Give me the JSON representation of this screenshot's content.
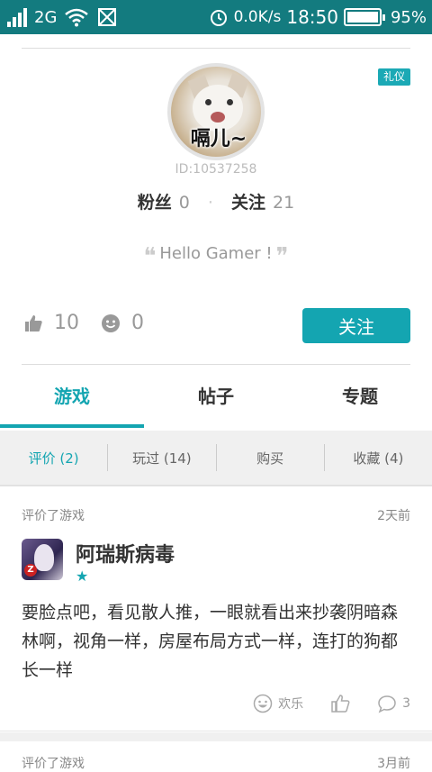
{
  "status": {
    "network": "2G",
    "speed": "0.0K/s",
    "time": "18:50",
    "battery": "95%"
  },
  "profile": {
    "badge": "礼仪",
    "avatar_caption": "嗝儿~",
    "id_text": "ID:10537258",
    "fans_label": "粉丝",
    "fans_count": "0",
    "follow_label": "关注",
    "follow_count": "21",
    "motto": "Hello Gamer !",
    "likes": "10",
    "smiles": "0",
    "follow_button": "关注"
  },
  "tabs": [
    {
      "label": "游戏",
      "active": true
    },
    {
      "label": "帖子",
      "active": false
    },
    {
      "label": "专题",
      "active": false
    }
  ],
  "subtabs": [
    {
      "label": "评价 (2)",
      "active": true
    },
    {
      "label": "玩过 (14)",
      "active": false
    },
    {
      "label": "购买",
      "active": false
    },
    {
      "label": "收藏 (4)",
      "active": false
    }
  ],
  "reviews": [
    {
      "action": "评价了游戏",
      "time": "2天前",
      "game": "阿瑞斯病毒",
      "stars": "★",
      "text": "要脸点吧，看见散人推，一眼就看出来抄袭阴暗森林啊，视角一样，房屋布局方式一样，连打的狗都长一样",
      "emotion_label": "欢乐",
      "comments": "3"
    },
    {
      "action": "评价了游戏",
      "time": "3月前"
    }
  ],
  "colors": {
    "accent": "#14a5b1",
    "statusbar": "#137b7f"
  }
}
